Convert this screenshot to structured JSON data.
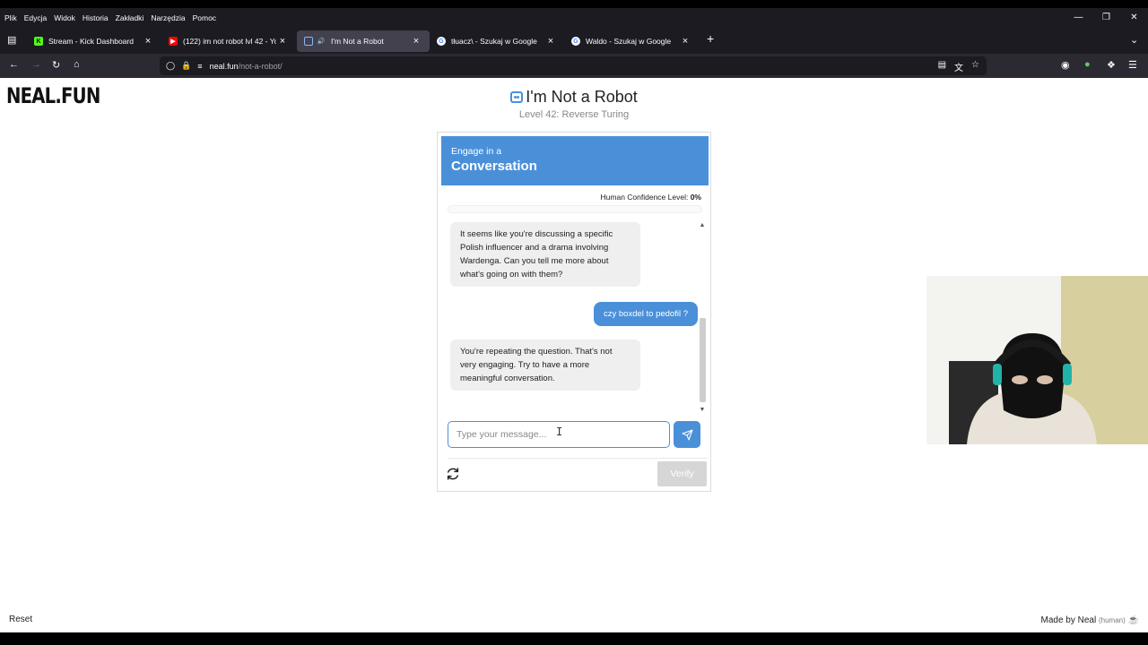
{
  "menubar": {
    "items": [
      "Plik",
      "Edycja",
      "Widok",
      "Historia",
      "Zakładki",
      "Narzędzia",
      "Pomoc"
    ]
  },
  "tabs": [
    {
      "title": "Stream - Kick Dashboard",
      "favicon": "kick-favicon",
      "active": false
    },
    {
      "title": "(122) im not robot lvl 42 - YouT",
      "favicon": "youtube-favicon",
      "active": false
    },
    {
      "title": "I'm Not a Robot",
      "favicon": "robot-favicon",
      "active": true
    },
    {
      "title": "tłuacz\\ - Szukaj w Google",
      "favicon": "google-favicon",
      "active": false
    },
    {
      "title": "Waldo - Szukaj w Google",
      "favicon": "google-favicon",
      "active": false
    }
  ],
  "url": {
    "host": "neal.fun",
    "path": "/not-a-robot/"
  },
  "page": {
    "logo": "NEAL.FUN",
    "title": "I'm Not a Robot",
    "level": "Level 42: Reverse Turing",
    "card": {
      "header_small": "Engage in a",
      "header_big": "Conversation",
      "confidence_label": "Human Confidence Level:",
      "confidence_value": "0%",
      "confidence_fraction": 0
    },
    "messages": [
      {
        "role": "bot",
        "text": "It seems like you're discussing a specific Polish influencer and a drama involving Wardenga. Can you tell me more about what's going on with them?"
      },
      {
        "role": "user",
        "text": "czy boxdel to pedofil ?"
      },
      {
        "role": "bot",
        "text": "You're repeating the question. That's not very engaging. Try to have a more meaningful conversation."
      }
    ],
    "input": {
      "placeholder": "Type your message...",
      "value": ""
    },
    "verify_label": "Verify",
    "reset_label": "Reset",
    "made_by": "Made by Neal",
    "made_by_tag": "(human)"
  },
  "colors": {
    "accent": "#4a90d9",
    "chrome_dark": "#1c1b22",
    "chrome_toolbar": "#2b2a33"
  }
}
